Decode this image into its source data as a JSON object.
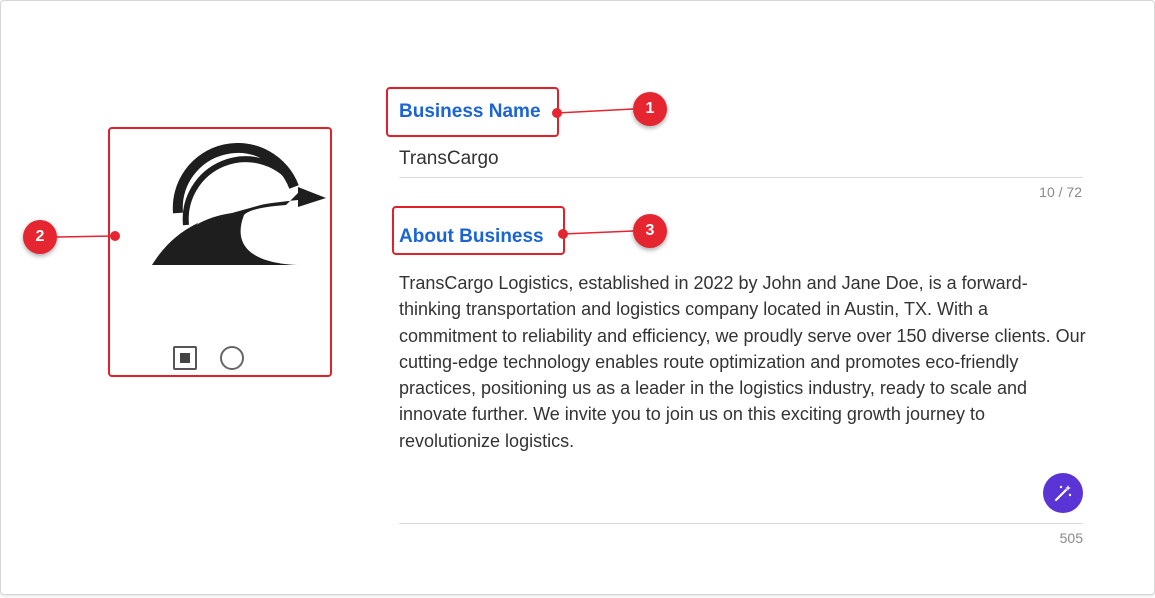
{
  "logo": {
    "image_icon": "transcargo-logo",
    "options": [
      {
        "icon": "square-option-icon",
        "selected": true
      },
      {
        "icon": "circle-option-icon",
        "selected": false
      }
    ]
  },
  "business_name": {
    "label": "Business Name",
    "value": "TransCargo",
    "counter": "10 / 72"
  },
  "about": {
    "label": "About Business",
    "value": "TransCargo Logistics, established in 2022 by John and Jane Doe, is a forward-thinking transportation and logistics company located in Austin, TX. With a commitment to reliability and efficiency, we proudly serve over 150 diverse clients. Our cutting-edge technology enables route optimization and promotes eco-friendly practices, positioning us as a leader in the logistics industry, ready to scale and innovate further. We invite you to join us on this exciting growth journey to revolutionize logistics.",
    "counter": "505",
    "ai_button_icon": "magic-wand-icon"
  },
  "annotations": [
    {
      "number": "1",
      "target": "Business Name"
    },
    {
      "number": "2",
      "target": "logo"
    },
    {
      "number": "3",
      "target": "About Business"
    }
  ],
  "colors": {
    "label": "#1a64d6",
    "annotation": "#e5252f",
    "ai_button": "#5b34d6"
  }
}
